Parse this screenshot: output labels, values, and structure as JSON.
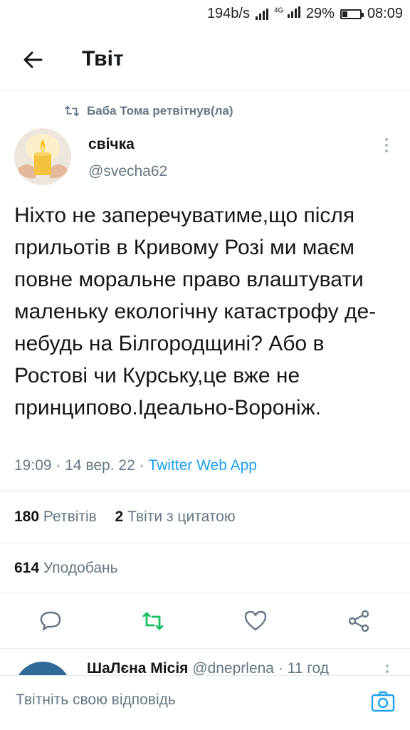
{
  "status_bar": {
    "net_speed": "194b/s",
    "net_type": "4G",
    "battery": "29%",
    "battery_level": 0.29,
    "time": "08:09"
  },
  "header": {
    "title": "Твіт"
  },
  "tweet": {
    "retweeted_by": "Баба Тома ретвітнув(ла)",
    "author_name": "свічка",
    "author_handle": "@svecha62",
    "text": "Ніхто не заперечуватиме,що після прильотів в Кривому Розі ми маєм повне моральне право влаштувати маленьку екологічну катастрофу де-небудь на Білгородщині? Або в Ростові чи Курську,це вже не принципово.Ідеально-Вороніж.",
    "time": "19:09",
    "date": "14 вер. 22",
    "separator": "·",
    "source": "Twitter Web App"
  },
  "stats": {
    "retweets_count": "180",
    "retweets_label": "Ретвітів",
    "quotes_count": "2",
    "quotes_label": "Твіти з цитатою",
    "likes_count": "614",
    "likes_label": "Уподобань"
  },
  "next_tweet": {
    "author_name": "ШаЛєна Місія",
    "author_handle": "@dneprlena · 11 год"
  },
  "reply": {
    "placeholder": "Твітніть свою відповідь"
  },
  "colors": {
    "accent": "#1da1f2",
    "retweet_active": "#17bf63",
    "secondary_text": "#657786"
  }
}
